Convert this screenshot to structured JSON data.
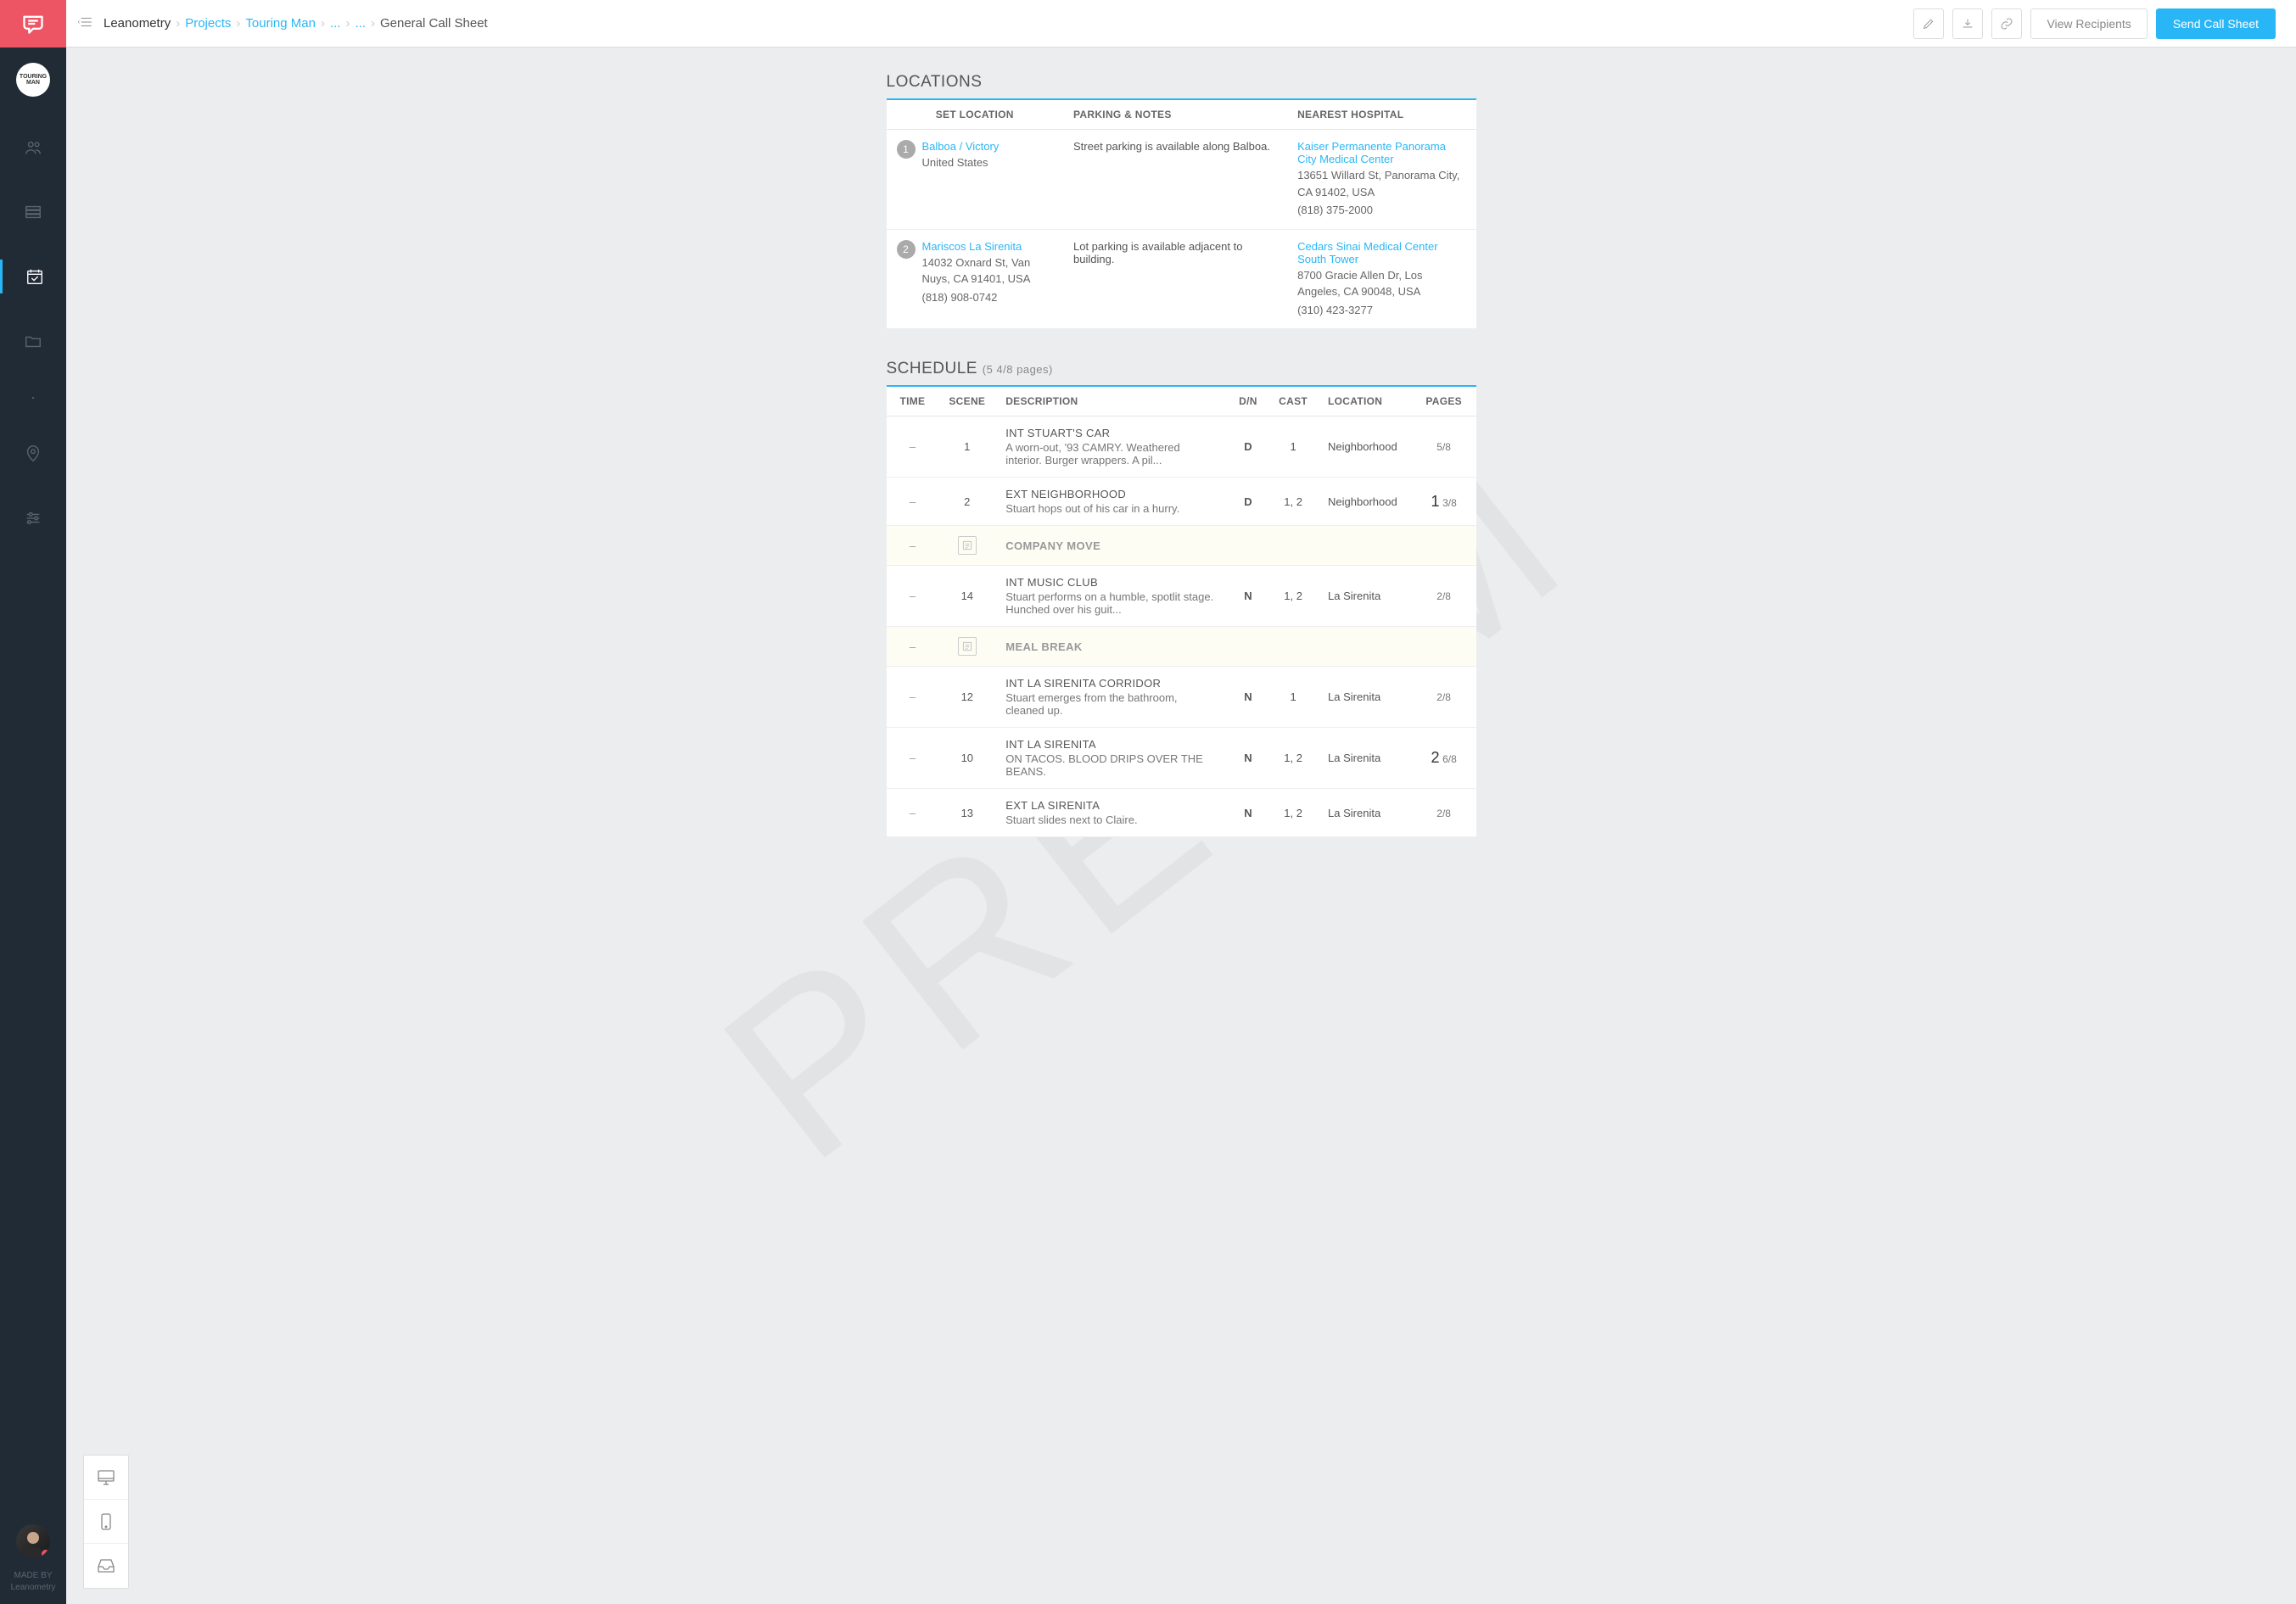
{
  "watermark": "PRELIM",
  "sidebar": {
    "project_initials": "TOURING MAN",
    "made_by_line1": "MADE BY",
    "made_by_line2": "Leanometry"
  },
  "breadcrumb": {
    "root": "Leanometry",
    "items": [
      "Projects",
      "Touring Man",
      "...",
      "..."
    ],
    "current": "General Call Sheet"
  },
  "actions": {
    "view_recipients": "View Recipients",
    "send": "Send Call Sheet"
  },
  "locations": {
    "header": "LOCATIONS",
    "columns": {
      "set": "SET LOCATION",
      "parking": "PARKING & NOTES",
      "hospital": "NEAREST HOSPITAL"
    },
    "rows": [
      {
        "num": "1",
        "name": "Balboa / Victory",
        "address": "United States",
        "phone": "",
        "parking": "Street parking is available along Balboa.",
        "hospital_name": "Kaiser Permanente Panorama City Medical Center",
        "hospital_addr": "13651 Willard St, Panorama City, CA 91402, USA",
        "hospital_phone": "(818) 375-2000"
      },
      {
        "num": "2",
        "name": "Mariscos La Sirenita",
        "address": "14032 Oxnard St, Van Nuys, CA 91401, USA",
        "phone": "(818) 908-0742",
        "parking": "Lot parking is available adjacent to building.",
        "hospital_name": "Cedars Sinai Medical Center South Tower",
        "hospital_addr": "8700 Gracie Allen Dr, Los Angeles, CA 90048, USA",
        "hospital_phone": "(310) 423-3277"
      }
    ]
  },
  "schedule": {
    "header": "SCHEDULE",
    "page_count": "(5 4/8 pages)",
    "columns": {
      "time": "TIME",
      "scene": "SCENE",
      "description": "DESCRIPTION",
      "dn": "D/N",
      "cast": "CAST",
      "location": "LOCATION",
      "pages": "PAGES"
    },
    "breaks": {
      "company_move": "COMPANY MOVE",
      "meal_break": "MEAL BREAK"
    },
    "rows": [
      {
        "type": "scene",
        "time": "–",
        "scene": "1",
        "title": "INT STUART'S CAR",
        "desc": "A worn-out, '93 CAMRY. Weathered interior. Burger wrappers. A pil...",
        "dn": "D",
        "cast": "1",
        "location": "Neighborhood",
        "pages_whole": "",
        "pages_frac": "5/8"
      },
      {
        "type": "scene",
        "time": "–",
        "scene": "2",
        "title": "EXT NEIGHBORHOOD",
        "desc": "Stuart hops out of his car in a hurry.",
        "dn": "D",
        "cast": "1, 2",
        "location": "Neighborhood",
        "pages_whole": "1",
        "pages_frac": "3/8"
      },
      {
        "type": "break",
        "label_key": "company_move"
      },
      {
        "type": "scene",
        "time": "–",
        "scene": "14",
        "title": "INT MUSIC CLUB",
        "desc": "Stuart performs on a humble, spotlit stage. Hunched over his guit...",
        "dn": "N",
        "cast": "1, 2",
        "location": "La Sirenita",
        "pages_whole": "",
        "pages_frac": "2/8"
      },
      {
        "type": "break",
        "label_key": "meal_break"
      },
      {
        "type": "scene",
        "time": "–",
        "scene": "12",
        "title": "INT LA SIRENITA CORRIDOR",
        "desc": "Stuart emerges from the bathroom, cleaned up.",
        "dn": "N",
        "cast": "1",
        "location": "La Sirenita",
        "pages_whole": "",
        "pages_frac": "2/8"
      },
      {
        "type": "scene",
        "time": "–",
        "scene": "10",
        "title": "INT LA SIRENITA",
        "desc": "ON TACOS. BLOOD DRIPS OVER THE BEANS.",
        "dn": "N",
        "cast": "1, 2",
        "location": "La Sirenita",
        "pages_whole": "2",
        "pages_frac": "6/8"
      },
      {
        "type": "scene",
        "time": "–",
        "scene": "13",
        "title": "EXT LA SIRENITA",
        "desc": "Stuart slides next to Claire.",
        "dn": "N",
        "cast": "1, 2",
        "location": "La Sirenita",
        "pages_whole": "",
        "pages_frac": "2/8"
      }
    ]
  }
}
